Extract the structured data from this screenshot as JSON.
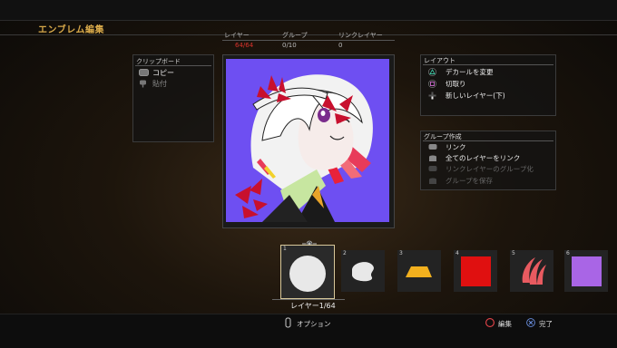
{
  "screen_title": "エンブレム編集",
  "counters": {
    "layer_label": "レイヤー",
    "layer_value": "64/64",
    "group_label": "グループ",
    "group_value": "0/10",
    "link_label": "リンクレイヤー",
    "link_value": "0",
    "layer_value_color": "#d9322b"
  },
  "clipboard": {
    "title": "クリップボード",
    "items": [
      {
        "label": "コピー",
        "icon": "touchpad-icon",
        "enabled": true
      },
      {
        "label": "貼付",
        "icon": "touchpad-press-icon",
        "enabled": false
      }
    ]
  },
  "layout_panel": {
    "title": "レイアウト",
    "items": [
      {
        "label": "デカールを変更",
        "icon": "triangle-button-icon"
      },
      {
        "label": "切取り",
        "icon": "square-button-icon"
      },
      {
        "label": "新しいレイヤー(下)",
        "icon": "dpad-down-icon"
      }
    ]
  },
  "group_panel": {
    "title": "グループ作成",
    "items": [
      {
        "label": "リンク",
        "icon": "l1-button-icon",
        "enabled": true
      },
      {
        "label": "全てのレイヤーをリンク",
        "icon": "l2-button-icon",
        "enabled": true
      },
      {
        "label": "リンクレイヤーのグループ化",
        "icon": "r1-button-icon",
        "enabled": false
      },
      {
        "label": "グループを保存",
        "icon": "r2-button-icon",
        "enabled": false
      }
    ]
  },
  "layers": [
    {
      "num": "1",
      "shape": "circle",
      "color": "#e8e8e8",
      "selected": true
    },
    {
      "num": "2",
      "shape": "blob",
      "color": "#e8e8e8"
    },
    {
      "num": "3",
      "shape": "trapezoid",
      "color": "#f2b01e"
    },
    {
      "num": "4",
      "shape": "square",
      "color": "#e01010"
    },
    {
      "num": "5",
      "shape": "claw",
      "color": "#e85a60"
    },
    {
      "num": "6",
      "shape": "square",
      "color": "#a965e6"
    }
  ],
  "layer_indicator": "レイヤー1/64",
  "bottom": {
    "options": "オプション",
    "options_icon": "options-button-icon",
    "edit": "編集",
    "edit_icon": "circle-button-icon",
    "done": "完了",
    "done_icon": "cross-button-icon"
  },
  "colors": {
    "accent_title": "#d8a94a",
    "canvas_bg": "#6e4ff2",
    "selection_border": "#d8c89a"
  }
}
